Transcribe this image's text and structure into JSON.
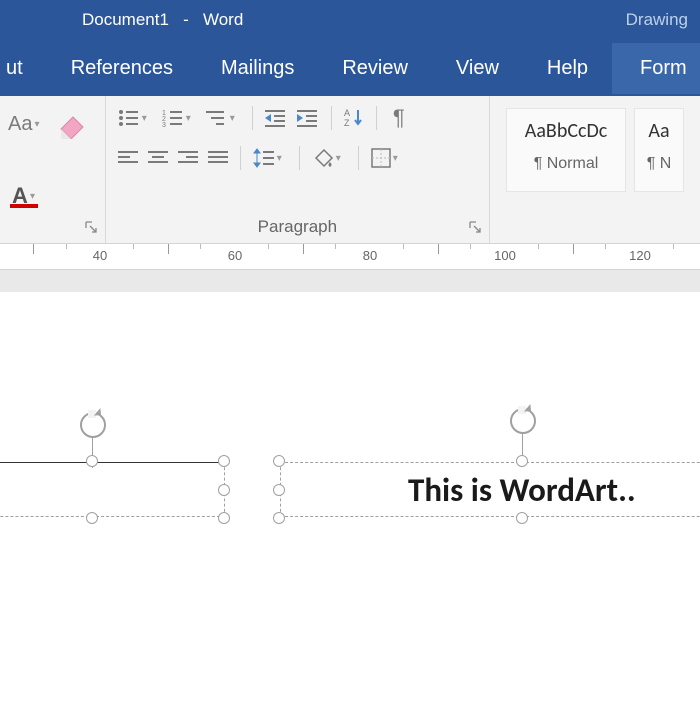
{
  "title": {
    "doc": "Document1",
    "sep": "-",
    "app": "Word",
    "context_tab_group": "Drawing"
  },
  "tabs": {
    "t0": "ut",
    "t1": "References",
    "t2": "Mailings",
    "t3": "Review",
    "t4": "View",
    "t5": "Help",
    "t6": "Form"
  },
  "ribbon": {
    "paragraph_label": "Paragraph",
    "styles": {
      "s0_preview": "AaBbCcDc",
      "s0_name": "¶ Normal",
      "s1_preview": "Aa",
      "s1_name": "¶ N"
    }
  },
  "ruler": {
    "labels": [
      "40",
      "60",
      "80",
      "100",
      "120"
    ]
  },
  "canvas": {
    "wordart_text": "This is WordArt.."
  },
  "icons": {
    "caseAa": "Aa",
    "fontA": "A",
    "bullets": "•",
    "numbers": "1",
    "multilevel": "a",
    "sort_az": "A",
    "sort_z": "Z",
    "pilcrow": "¶"
  }
}
